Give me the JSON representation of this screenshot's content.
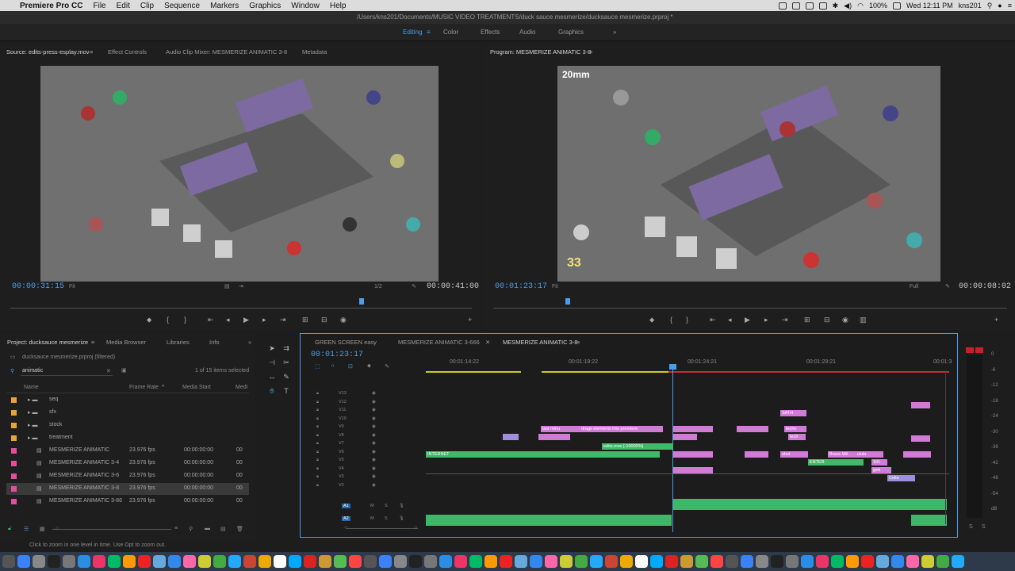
{
  "menubar": {
    "app": "Premiere Pro CC",
    "items": [
      "File",
      "Edit",
      "Clip",
      "Sequence",
      "Markers",
      "Graphics",
      "Window",
      "Help"
    ],
    "battery": "100%",
    "date": "Wed 12:11 PM",
    "user": "kns201"
  },
  "title": "/Users/kns201/Documents/MUSIC VIDEO TREATMENTS/duck sauce mesmerize/ducksauce mesmerize.prproj *",
  "workspaces": [
    "Editing",
    "Color",
    "Effects",
    "Audio",
    "Graphics"
  ],
  "source": {
    "tabs": [
      "Source: edits-press-esplay.mov",
      "Effect Controls",
      "Audio Clip Mixer: MESMERIZE ANIMATIC 3-8",
      "Metadata"
    ],
    "timecode": "00:00:31:15",
    "fit": "Fit",
    "ratio": "1/2",
    "duration": "00:00:41:00"
  },
  "program": {
    "tab": "Program: MESMERIZE ANIMATIC 3-8",
    "overlay_lens": "20mm",
    "overlay_num": "33",
    "timecode": "00:01:23:17",
    "fit": "Fit",
    "quality": "Full",
    "duration": "00:00:08:02"
  },
  "project": {
    "tabs": [
      "Project: ducksauce mesmerize",
      "Media Browser",
      "Libraries",
      "Info"
    ],
    "file": "ducksauce mesmerize.prproj (filtered)",
    "search": "animatic",
    "count": "1 of 15 items selected",
    "columns": [
      "Name",
      "Frame Rate",
      "Media Start",
      "Medi"
    ],
    "items": [
      {
        "name": "seq",
        "type": "bin",
        "color": "#e7a33a"
      },
      {
        "name": "sfx",
        "type": "bin",
        "color": "#e7a33a"
      },
      {
        "name": "stock",
        "type": "bin",
        "color": "#e7a33a"
      },
      {
        "name": "treatment",
        "type": "bin",
        "color": "#e7a33a"
      },
      {
        "name": "MESMERIZE ANIMATIC",
        "fps": "23.976 fps",
        "start": "00:00:00:00",
        "m": "00",
        "color": "#e04f9d"
      },
      {
        "name": "MESMERIZE ANIMATIC 3-4",
        "fps": "23.976 fps",
        "start": "00:00:00:00",
        "m": "00",
        "color": "#e04f9d"
      },
      {
        "name": "MESMERIZE ANIMATIC 3-6",
        "fps": "23.976 fps",
        "start": "00:00:00:00",
        "m": "00",
        "color": "#e04f9d"
      },
      {
        "name": "MESMERIZE ANIMATIC 3-8",
        "fps": "23.976 fps",
        "start": "00:00:00:00",
        "m": "00",
        "color": "#e04f9d"
      },
      {
        "name": "MESMERIZE ANIMATIC 3-66",
        "fps": "23.976 fps",
        "start": "00:00:00:00",
        "m": "00",
        "color": "#e04f9d"
      }
    ]
  },
  "timeline": {
    "tabs": [
      "GREEN SCREEN easy",
      "MESMERIZE ANIMATIC 3-666",
      "MESMERIZE ANIMATIC 3-8"
    ],
    "timecode": "00:01:23:17",
    "ruler": [
      "00:01:14:22",
      "00:01:19:22",
      "00:01:24:21",
      "00:01:29:21",
      "00:01:3"
    ],
    "video_tracks": [
      "V13",
      "V12",
      "V11",
      "V10",
      "V9",
      "V8",
      "V7",
      "V6",
      "V5",
      "V4",
      "V3",
      "V2"
    ],
    "audio_tracks": [
      "A1",
      "A2"
    ],
    "clip_labels": [
      "last minu",
      "drags elements into premiere",
      "edits.mov [-10000%]",
      "INTERNET",
      "SATH",
      "techn",
      "tech",
      "shot",
      "Bruce Wil",
      "ENTER",
      "101",
      "gett",
      "Colla",
      "clulo"
    ]
  },
  "meter": [
    "0",
    "-6",
    "-12",
    "-18",
    "-24",
    "-30",
    "-36",
    "-42",
    "-48",
    "-54",
    "dB"
  ],
  "status": "Click to zoom in one level in time. Use Opt to zoom out."
}
